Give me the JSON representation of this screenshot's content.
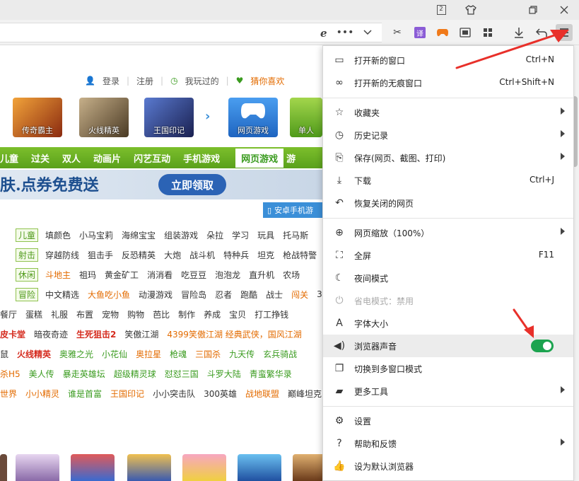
{
  "titlebar": {
    "tab_count": "2"
  },
  "toplinks": {
    "login": "登录",
    "register": "注册",
    "played": "我玩过的",
    "guess": "猜你喜欢"
  },
  "gamecards": [
    {
      "label": "传奇霸主",
      "color": "#8a2a10"
    },
    {
      "label": "火线精英",
      "color": "#6b5a3a"
    },
    {
      "label": "王国印记",
      "color": "#2a3a7a"
    },
    {
      "label": "网页游戏",
      "color": "#2f78d0"
    },
    {
      "label": "单人",
      "color": "#6dbb2a"
    }
  ],
  "navbar": {
    "items": [
      "儿童",
      "过关",
      "双人",
      "动画片",
      "闪艺互动",
      "手机游戏"
    ],
    "tab_web": "网页游戏",
    "tab_more": "游"
  },
  "banner": {
    "text": "肤.点券免费送",
    "button": "立即领取"
  },
  "android": "安卓手机游",
  "rows": [
    {
      "tag": "儿童",
      "items": [
        [
          "填颜色",
          ""
        ],
        [
          "小马宝莉",
          ""
        ],
        [
          "海绵宝宝",
          ""
        ],
        [
          "组装游戏",
          ""
        ],
        [
          "朵拉",
          ""
        ],
        [
          "学习",
          ""
        ],
        [
          "玩具",
          ""
        ],
        [
          "托马斯",
          ""
        ]
      ]
    },
    {
      "tag": "射击",
      "items": [
        [
          "穿越防线",
          ""
        ],
        [
          "狙击手",
          ""
        ],
        [
          "反恐精英",
          ""
        ],
        [
          "大炮",
          ""
        ],
        [
          "战斗机",
          ""
        ],
        [
          "特种兵",
          ""
        ],
        [
          "坦克",
          ""
        ],
        [
          "枪战特警",
          ""
        ]
      ]
    },
    {
      "tag": "休闲",
      "items": [
        [
          "斗地主",
          "o"
        ],
        [
          "祖玛",
          ""
        ],
        [
          "黄金矿工",
          ""
        ],
        [
          "消消看",
          ""
        ],
        [
          "吃豆豆",
          ""
        ],
        [
          "泡泡龙",
          ""
        ],
        [
          "直升机",
          ""
        ],
        [
          "农场",
          ""
        ]
      ]
    },
    {
      "tag": "冒险",
      "items": [
        [
          "中文精选",
          ""
        ],
        [
          "大鱼吃小鱼",
          "o"
        ],
        [
          "动漫游戏",
          ""
        ],
        [
          "冒险岛",
          ""
        ],
        [
          "忍者",
          ""
        ],
        [
          "跑酷",
          ""
        ],
        [
          "战士",
          ""
        ],
        [
          "闯关",
          "o"
        ],
        [
          "3",
          ""
        ]
      ]
    },
    {
      "tag": "",
      "items": [
        [
          "餐厅",
          ""
        ],
        [
          "蛋糕",
          ""
        ],
        [
          "礼服",
          ""
        ],
        [
          "布置",
          ""
        ],
        [
          "宠物",
          ""
        ],
        [
          "购物",
          ""
        ],
        [
          "芭比",
          ""
        ],
        [
          "制作",
          ""
        ],
        [
          "养成",
          ""
        ],
        [
          "宝贝",
          ""
        ],
        [
          "打工挣钱",
          ""
        ]
      ]
    },
    {
      "tag": "",
      "items": [
        [
          "皮卡堂",
          "rb"
        ],
        [
          "暗夜奇迹",
          ""
        ],
        [
          "生死狙击2",
          "rb"
        ],
        [
          "笑傲江湖",
          ""
        ],
        [
          "4399笑傲江湖 经典武侠，国风江湖",
          "o"
        ]
      ]
    },
    {
      "tag": "",
      "items": [
        [
          "鼠",
          ""
        ],
        [
          "火线精英",
          "rb"
        ],
        [
          "奥雅之光",
          "g"
        ],
        [
          "小花仙",
          "g"
        ],
        [
          "奥拉星",
          "o"
        ],
        [
          "枪魂",
          "g"
        ],
        [
          "三国杀",
          "o"
        ],
        [
          "九天传",
          "g"
        ],
        [
          "玄兵骑战",
          "g"
        ]
      ]
    },
    {
      "tag": "",
      "items": [
        [
          "杀H5",
          "o"
        ],
        [
          "美人传",
          "g"
        ],
        [
          "暴走英雄坛",
          "g"
        ],
        [
          "超级精灵球",
          "g"
        ],
        [
          "怼怼三国",
          "g"
        ],
        [
          "斗罗大陆",
          "g"
        ],
        [
          "青蛮繁华录",
          "g"
        ]
      ]
    },
    {
      "tag": "",
      "items": [
        [
          "世界",
          "o"
        ],
        [
          "小小精灵",
          "o"
        ],
        [
          "谁是首富",
          "g"
        ],
        [
          "王国印记",
          "o"
        ],
        [
          "小小突击队",
          ""
        ],
        [
          "300英雄",
          ""
        ],
        [
          "战地联盟",
          "o"
        ],
        [
          "巅峰坦克",
          ""
        ]
      ]
    }
  ],
  "menu": {
    "items": [
      {
        "icon": "window-icon",
        "glyph": "▭",
        "label": "打开新的窗口",
        "shortcut": "Ctrl+N",
        "arrow": false
      },
      {
        "icon": "incognito-icon",
        "glyph": "∞",
        "label": "打开新的无痕窗口",
        "shortcut": "Ctrl+Shift+N",
        "arrow": false
      },
      {
        "icon": "favorites-icon",
        "glyph": "☆",
        "label": "收藏夹",
        "shortcut": "",
        "arrow": true
      },
      {
        "icon": "history-icon",
        "glyph": "◷",
        "label": "历史记录",
        "shortcut": "",
        "arrow": true
      },
      {
        "icon": "save-icon",
        "glyph": "⎘",
        "label": "保存(网页、截图、打印)",
        "shortcut": "",
        "arrow": true
      },
      {
        "icon": "download-icon",
        "glyph": "⤓",
        "label": "下载",
        "shortcut": "Ctrl+J",
        "arrow": false
      },
      {
        "icon": "restore-icon",
        "glyph": "↶",
        "label": "恢复关闭的网页",
        "shortcut": "",
        "arrow": false
      },
      {
        "icon": "zoom-icon",
        "glyph": "⊕",
        "label": "网页缩放（100%）",
        "shortcut": "",
        "arrow": true
      },
      {
        "icon": "fullscreen-icon",
        "glyph": "⛶",
        "label": "全屏",
        "shortcut": "F11",
        "arrow": false
      },
      {
        "icon": "night-mode-icon",
        "glyph": "☾",
        "label": "夜间模式",
        "shortcut": "",
        "arrow": false
      },
      {
        "icon": "power-save-icon",
        "glyph": "⏻",
        "label": "省电模式：禁用",
        "shortcut": "",
        "arrow": false,
        "disabled": true
      },
      {
        "icon": "font-size-icon",
        "glyph": "A",
        "label": "字体大小",
        "shortcut": "",
        "arrow": false
      },
      {
        "icon": "speaker-icon",
        "glyph": "◀)",
        "label": "浏览器声音",
        "shortcut": "",
        "arrow": false,
        "toggle": true
      },
      {
        "icon": "multi-window-icon",
        "glyph": "❐",
        "label": "切换到多窗口模式",
        "shortcut": "",
        "arrow": false
      },
      {
        "icon": "toolbox-icon",
        "glyph": "▰",
        "label": "更多工具",
        "shortcut": "",
        "arrow": true
      },
      {
        "icon": "settings-icon",
        "glyph": "⚙",
        "label": "设置",
        "shortcut": "",
        "arrow": false
      },
      {
        "icon": "help-icon",
        "glyph": "?",
        "label": "帮助和反馈",
        "shortcut": "",
        "arrow": true
      },
      {
        "icon": "thumbs-up-icon",
        "glyph": "👍",
        "label": "设为默认浏览器",
        "shortcut": "",
        "arrow": false
      }
    ]
  },
  "colors": {
    "toggle_on": "#1ca34f",
    "annotation_arrow": "#e8302a",
    "nav_green": "#5aa11b"
  }
}
